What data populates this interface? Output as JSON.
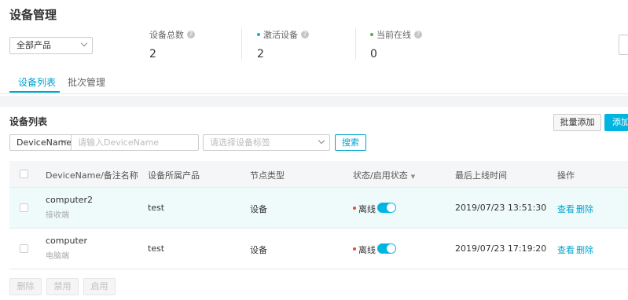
{
  "header": {
    "title": "设备管理"
  },
  "filter": {
    "product_value": "全部产品"
  },
  "stats": [
    {
      "label": "设备总数",
      "value": "2",
      "dot_color": ""
    },
    {
      "label": "激活设备",
      "value": "2",
      "dot_color": "#00b6e0"
    },
    {
      "label": "当前在线",
      "value": "0",
      "dot_color": "#4caf50"
    }
  ],
  "tabs": [
    {
      "label": "设备列表",
      "active": true
    },
    {
      "label": "批次管理",
      "active": false
    }
  ],
  "list": {
    "title": "设备列表",
    "batch_add_label": "批量添加",
    "add_label": "添加",
    "search_field_value": "DeviceName",
    "search_placeholder": "请输入DeviceName",
    "tag_placeholder": "请选择设备标签",
    "search_button": "搜索"
  },
  "table": {
    "columns": [
      "DeviceName/备注名称",
      "设备所属产品",
      "节点类型",
      "状态/启用状态",
      "最后上线时间",
      "操作"
    ],
    "rows": [
      {
        "name": "computer2",
        "remark": "接收端",
        "product": "test",
        "node_type": "设备",
        "status": "离线",
        "enabled": true,
        "last_online": "2019/07/23 13:51:30",
        "action_view": "查看",
        "action_delete": "删除"
      },
      {
        "name": "computer",
        "remark": "电脑端",
        "product": "test",
        "node_type": "设备",
        "status": "离线",
        "enabled": true,
        "last_online": "2019/07/23 17:19:20",
        "action_view": "查看",
        "action_delete": "删除"
      }
    ]
  },
  "bulk_actions": [
    "删除",
    "禁用",
    "启用"
  ],
  "colors": {
    "accent": "#00a3d1",
    "primary_button": "#00b6e0",
    "offline": "#e84a32",
    "row_highlight": "#effafb"
  }
}
